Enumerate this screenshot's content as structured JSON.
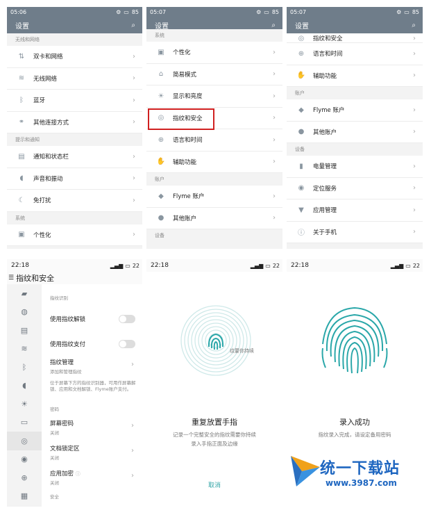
{
  "p1": {
    "time": "05:06",
    "battery": "85",
    "title": "设置",
    "sections": [
      {
        "header": "无线和网络",
        "items": [
          {
            "icon": "⇅",
            "label": "双卡和网络"
          },
          {
            "icon": "≋",
            "label": "无线网络"
          },
          {
            "icon": "ᛒ",
            "label": "蓝牙"
          },
          {
            "icon": "⚭",
            "label": "其他连接方式"
          }
        ]
      },
      {
        "header": "提示和通知",
        "items": [
          {
            "icon": "▤",
            "label": "通知和状态栏"
          },
          {
            "icon": "◖",
            "label": "声音和振动"
          },
          {
            "icon": "☾",
            "label": "免打扰"
          }
        ]
      },
      {
        "header": "系统",
        "items": [
          {
            "icon": "▣",
            "label": "个性化"
          }
        ]
      }
    ]
  },
  "p2": {
    "time": "05:07",
    "battery": "85",
    "title": "设置",
    "sections": [
      {
        "header": "系统",
        "items": [
          {
            "icon": "▣",
            "label": "个性化"
          },
          {
            "icon": "⌂",
            "label": "简易模式"
          },
          {
            "icon": "☀",
            "label": "显示和亮度"
          },
          {
            "icon": "◎",
            "label": "指纹和安全"
          },
          {
            "icon": "⊕",
            "label": "语言和时间"
          },
          {
            "icon": "✋",
            "label": "辅助功能"
          }
        ]
      },
      {
        "header": "账户",
        "items": [
          {
            "icon": "◆",
            "label": "Flyme 账户"
          },
          {
            "icon": "●",
            "label": "其他账户"
          }
        ]
      },
      {
        "header": "设备",
        "items": []
      }
    ]
  },
  "p3": {
    "time": "05:07",
    "battery": "85",
    "title": "设置",
    "top_item": {
      "icon": "◎",
      "label": "指纹和安全"
    },
    "sections": [
      {
        "header": "",
        "items": [
          {
            "icon": "⊕",
            "label": "语言和时间"
          },
          {
            "icon": "✋",
            "label": "辅助功能"
          }
        ]
      },
      {
        "header": "账户",
        "items": [
          {
            "icon": "◆",
            "label": "Flyme 账户"
          },
          {
            "icon": "●",
            "label": "其他账户"
          }
        ]
      },
      {
        "header": "设备",
        "items": [
          {
            "icon": "▮",
            "label": "电量管理"
          },
          {
            "icon": "◉",
            "label": "定位服务"
          },
          {
            "icon": "▼",
            "label": "应用管理"
          },
          {
            "icon": "ⓘ",
            "label": "关于手机"
          }
        ]
      }
    ]
  },
  "p4": {
    "time": "22:18",
    "battery": "22",
    "title": "指纹和安全",
    "section_fp": "指纹识别",
    "unlock": "使用指纹解锁",
    "pay": "使用指纹支付",
    "manage": "指纹管理",
    "manage_sub": "添加和管理指纹",
    "desc": "位于屏幕下方的指纹识别器，可用作屏幕解锁、应用和文档解锁、Flyme账户支付。",
    "section_pw": "密码",
    "screen_pw": "屏幕密码",
    "screen_pw_sub": "关闭",
    "doc_lock": "文档锁定区",
    "doc_lock_sub": "关闭",
    "app_enc": "应用加密",
    "app_enc_sub": "关闭",
    "section_sec": "安全",
    "side_icons": [
      "▰",
      "◍",
      "▤",
      "≋",
      "ᛒ",
      "◖",
      "☀",
      "▭",
      "◎",
      "◉",
      "⊕",
      "▦"
    ]
  },
  "p5": {
    "time": "22:18",
    "battery": "22",
    "hint": "纹要你持续",
    "title": "重复放置手指",
    "desc1": "记录一个完整安全的指纹需要你持续",
    "desc2": "录入手指正面及边缘",
    "cancel": "取消"
  },
  "p6": {
    "time": "22:18",
    "battery": "22",
    "title": "录入成功",
    "desc": "指纹录入完成，请设定备用密码"
  },
  "watermark": {
    "brand": "统一下载站",
    "url": "www.3987.com"
  },
  "colors": {
    "toolbar": "#6f7d8a",
    "fingerprint": "#2aa7a9",
    "highlight": "#d02020",
    "cancel": "#35a6a8"
  }
}
